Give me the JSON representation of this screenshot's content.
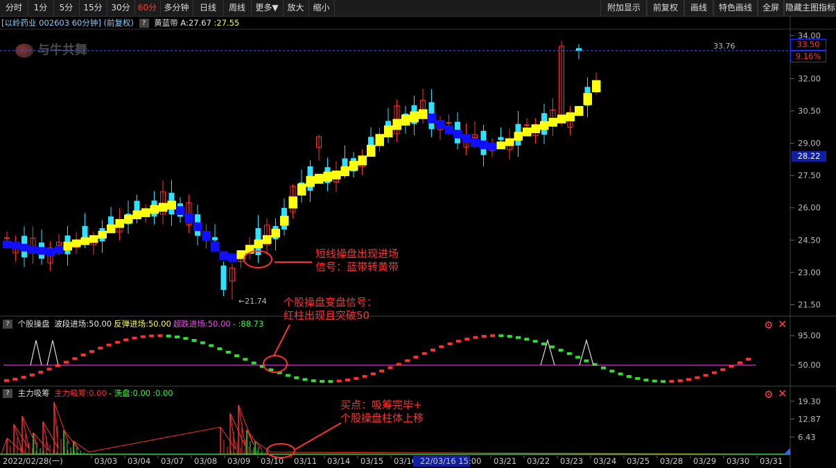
{
  "toolbar": {
    "left": [
      "分时",
      "1分",
      "5分",
      "15分",
      "30分",
      "60分",
      "多分钟",
      "日线",
      "周线",
      "更多▼",
      "放大",
      "缩小"
    ],
    "active": "60分",
    "right": [
      "附加显示",
      "前复权",
      "画线",
      "特色画线",
      "全屏",
      "隐藏主图指标"
    ]
  },
  "main": {
    "stock": "[以岭药业 002603 60分钟] (前复权)",
    "indicator_name": "黄蓝带",
    "a_label": "A:27.67",
    "b_label": ":27.55",
    "watermark": "与牛共舞",
    "high_label": "33.76",
    "low_label": "←21.74",
    "price_tag": "33.50",
    "pct_tag": "9.16%",
    "cur_tag": "28.22"
  },
  "ind1": {
    "name": "个股操盘",
    "items": [
      "波段进场:50.00",
      "反弹进场:50.00",
      "超跌进场:50.00",
      "- :88.73"
    ],
    "colors": [
      "#e8e8e8",
      "#ffff30",
      "#ff40ff",
      "#30ff30"
    ]
  },
  "ind2": {
    "name": "主力吸筹",
    "items": [
      "主力吸筹:0.00",
      "- 洗盘:0.00",
      ":0.00"
    ],
    "colors": [
      "#ff3030",
      "#30ff30",
      "#30ff30"
    ]
  },
  "annotations": {
    "a1_line1": "短线操盘出现进场",
    "a1_line2": "信号：蓝带转黄带",
    "a2_line1": "个股操盘变盘信号：",
    "a2_line2": "红柱出现且突破50",
    "a3_line1": "买点：吸筹完毕+",
    "a3_line2": "个股操盘柱体上移"
  },
  "colors": {
    "up": "#ff3030",
    "down": "#30e0ff",
    "band_yellow": "#ffff10",
    "band_blue": "#1010ff"
  },
  "chart_data": [
    {
      "type": "candlestick",
      "y_ticks": [
        "34.00",
        "32.00",
        "30.50",
        "29.00",
        "27.50",
        "26.00",
        "24.50",
        "23.00",
        "21.50"
      ],
      "ylim": [
        21.0,
        34.3
      ],
      "x_ticks": [
        "2022/02/28(一)",
        "03/03",
        "03/04",
        "03/07",
        "03/08",
        "03/09",
        "03/10",
        "03/11",
        "03/14",
        "03/15",
        "03/16",
        "22/03/16 15:00",
        "03/21",
        "03/22",
        "03/23",
        "03/24",
        "03/25",
        "03/28",
        "03/29",
        "03/30",
        "03/31"
      ],
      "series": [
        {
          "name": "黄蓝带 A",
          "values": [
            24.35,
            24.3,
            24.2,
            24.1,
            24.05,
            24.0,
            24.1,
            24.3,
            24.4,
            24.5,
            24.6,
            24.8,
            25.1,
            25.35,
            25.55,
            25.75,
            25.85,
            26.0,
            26.1,
            26.2,
            25.95,
            25.6,
            25.2,
            24.8,
            24.3,
            23.85,
            23.75,
            23.9,
            24.15,
            24.4,
            24.6,
            24.9,
            25.5,
            26.4,
            27.0,
            27.35,
            27.45,
            27.55,
            27.6,
            27.8,
            28.05,
            28.3,
            28.8,
            29.3,
            29.7,
            30.0,
            30.2,
            30.35,
            30.45,
            30.25,
            29.95,
            29.7,
            29.5,
            29.3,
            29.1,
            29.0,
            28.9,
            28.95,
            29.1,
            29.4,
            29.6,
            29.75,
            29.9,
            30.05,
            30.2,
            30.3,
            30.6,
            31.2,
            31.8
          ]
        },
        {
          "name": "黄蓝带 B",
          "values": [
            24.25,
            24.2,
            24.1,
            24.0,
            23.95,
            23.9,
            24.0,
            24.15,
            24.3,
            24.4,
            24.5,
            24.7,
            24.95,
            25.2,
            25.4,
            25.6,
            25.7,
            25.85,
            25.95,
            26.05,
            25.8,
            25.45,
            25.05,
            24.6,
            24.1,
            23.7,
            23.6,
            23.75,
            24.0,
            24.25,
            24.45,
            24.75,
            25.3,
            26.1,
            26.7,
            27.1,
            27.25,
            27.35,
            27.45,
            27.6,
            27.85,
            28.1,
            28.5,
            29.0,
            29.4,
            29.75,
            29.95,
            30.1,
            30.25,
            30.05,
            29.8,
            29.55,
            29.35,
            29.15,
            28.95,
            28.85,
            28.8,
            28.85,
            29.0,
            29.25,
            29.45,
            29.6,
            29.75,
            29.9,
            30.05,
            30.15,
            30.4,
            30.9,
            31.5
          ]
        }
      ]
    },
    {
      "type": "line",
      "name": "个股操盘",
      "y_ticks": [
        "95.00",
        "50.00"
      ],
      "ylim": [
        20,
        110
      ]
    },
    {
      "type": "bar",
      "name": "主力吸筹",
      "y_ticks": [
        "19.30",
        "12.87",
        "6.43"
      ],
      "ylim": [
        0,
        21
      ]
    }
  ]
}
